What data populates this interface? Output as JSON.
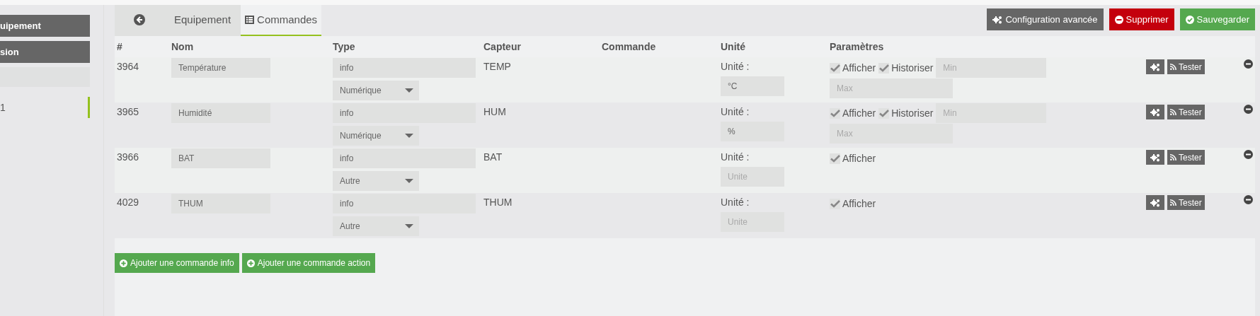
{
  "sidebar": {
    "items": [
      {
        "label": "uipement",
        "kind": "button",
        "selected": false
      },
      {
        "label": "sion",
        "kind": "button",
        "selected": false
      },
      {
        "kind": "field"
      },
      {
        "label": "1",
        "kind": "item",
        "selected": true
      }
    ]
  },
  "tabs": [
    {
      "kind": "back",
      "selected": false
    },
    {
      "label": "Equipement",
      "kind": "text",
      "selected": false
    },
    {
      "label": "Commandes",
      "kind": "list",
      "selected": true
    }
  ],
  "actions": [
    {
      "label": "Configuration avancée",
      "kind": "config"
    },
    {
      "label": "Supprimer",
      "kind": "delete"
    },
    {
      "label": "Sauvegarder",
      "kind": "save"
    }
  ],
  "table": {
    "columns": [
      "#",
      "Nom",
      "Type",
      "Capteur",
      "Commande",
      "Unité",
      "Paramètres"
    ],
    "rows": [
      {
        "id": "3964",
        "name": "Température",
        "type": "info",
        "subtype": "Numérique",
        "sensor": "TEMP",
        "unit_label": "Unité :",
        "unit": {
          "value": "°C"
        },
        "options": [
          {
            "label": "Afficher",
            "checked": true
          },
          {
            "label": "Historiser",
            "checked": true
          }
        ],
        "min_placeholder": "Min",
        "max_placeholder": "Max",
        "test_label": "Tester"
      },
      {
        "id": "3965",
        "name": "Humidité",
        "type": "info",
        "subtype": "Numérique",
        "sensor": "HUM",
        "unit_label": "Unité :",
        "unit": {
          "value": "%"
        },
        "options": [
          {
            "label": "Afficher",
            "checked": true
          },
          {
            "label": "Historiser",
            "checked": true
          }
        ],
        "min_placeholder": "Min",
        "max_placeholder": "Max",
        "test_label": "Tester"
      },
      {
        "id": "3966",
        "name": "BAT",
        "type": "info",
        "subtype": "Autre",
        "sensor": "BAT",
        "unit_label": "Unité :",
        "unit": {
          "placeholder": "Unite"
        },
        "options": [
          {
            "label": "Afficher",
            "checked": true
          }
        ],
        "test_label": "Tester"
      },
      {
        "id": "4029",
        "name": "THUM",
        "type": "info",
        "subtype": "Autre",
        "sensor": "THUM",
        "unit_label": "Unité :",
        "unit": {
          "placeholder": "Unite"
        },
        "options": [
          {
            "label": "Afficher",
            "checked": true
          }
        ],
        "test_label": "Tester"
      }
    ]
  },
  "add_buttons": [
    "Ajouter une commande info",
    "Ajouter une commande action"
  ]
}
